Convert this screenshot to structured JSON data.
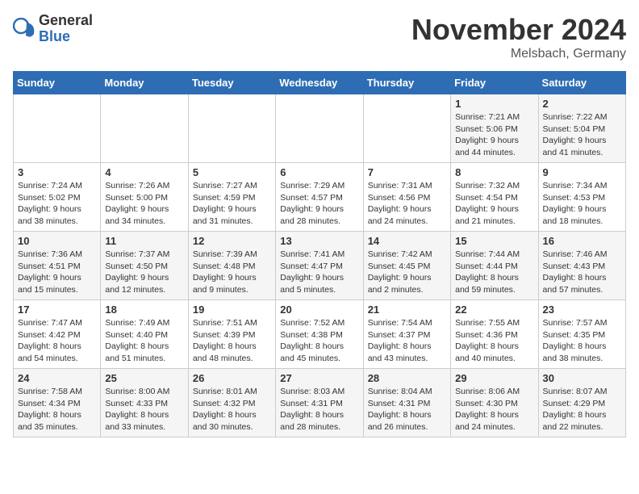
{
  "header": {
    "logo_general": "General",
    "logo_blue": "Blue",
    "month_title": "November 2024",
    "location": "Melsbach, Germany"
  },
  "weekdays": [
    "Sunday",
    "Monday",
    "Tuesday",
    "Wednesday",
    "Thursday",
    "Friday",
    "Saturday"
  ],
  "weeks": [
    [
      {
        "day": "",
        "content": ""
      },
      {
        "day": "",
        "content": ""
      },
      {
        "day": "",
        "content": ""
      },
      {
        "day": "",
        "content": ""
      },
      {
        "day": "",
        "content": ""
      },
      {
        "day": "1",
        "content": "Sunrise: 7:21 AM\nSunset: 5:06 PM\nDaylight: 9 hours and 44 minutes."
      },
      {
        "day": "2",
        "content": "Sunrise: 7:22 AM\nSunset: 5:04 PM\nDaylight: 9 hours and 41 minutes."
      }
    ],
    [
      {
        "day": "3",
        "content": "Sunrise: 7:24 AM\nSunset: 5:02 PM\nDaylight: 9 hours and 38 minutes."
      },
      {
        "day": "4",
        "content": "Sunrise: 7:26 AM\nSunset: 5:00 PM\nDaylight: 9 hours and 34 minutes."
      },
      {
        "day": "5",
        "content": "Sunrise: 7:27 AM\nSunset: 4:59 PM\nDaylight: 9 hours and 31 minutes."
      },
      {
        "day": "6",
        "content": "Sunrise: 7:29 AM\nSunset: 4:57 PM\nDaylight: 9 hours and 28 minutes."
      },
      {
        "day": "7",
        "content": "Sunrise: 7:31 AM\nSunset: 4:56 PM\nDaylight: 9 hours and 24 minutes."
      },
      {
        "day": "8",
        "content": "Sunrise: 7:32 AM\nSunset: 4:54 PM\nDaylight: 9 hours and 21 minutes."
      },
      {
        "day": "9",
        "content": "Sunrise: 7:34 AM\nSunset: 4:53 PM\nDaylight: 9 hours and 18 minutes."
      }
    ],
    [
      {
        "day": "10",
        "content": "Sunrise: 7:36 AM\nSunset: 4:51 PM\nDaylight: 9 hours and 15 minutes."
      },
      {
        "day": "11",
        "content": "Sunrise: 7:37 AM\nSunset: 4:50 PM\nDaylight: 9 hours and 12 minutes."
      },
      {
        "day": "12",
        "content": "Sunrise: 7:39 AM\nSunset: 4:48 PM\nDaylight: 9 hours and 9 minutes."
      },
      {
        "day": "13",
        "content": "Sunrise: 7:41 AM\nSunset: 4:47 PM\nDaylight: 9 hours and 5 minutes."
      },
      {
        "day": "14",
        "content": "Sunrise: 7:42 AM\nSunset: 4:45 PM\nDaylight: 9 hours and 2 minutes."
      },
      {
        "day": "15",
        "content": "Sunrise: 7:44 AM\nSunset: 4:44 PM\nDaylight: 8 hours and 59 minutes."
      },
      {
        "day": "16",
        "content": "Sunrise: 7:46 AM\nSunset: 4:43 PM\nDaylight: 8 hours and 57 minutes."
      }
    ],
    [
      {
        "day": "17",
        "content": "Sunrise: 7:47 AM\nSunset: 4:42 PM\nDaylight: 8 hours and 54 minutes."
      },
      {
        "day": "18",
        "content": "Sunrise: 7:49 AM\nSunset: 4:40 PM\nDaylight: 8 hours and 51 minutes."
      },
      {
        "day": "19",
        "content": "Sunrise: 7:51 AM\nSunset: 4:39 PM\nDaylight: 8 hours and 48 minutes."
      },
      {
        "day": "20",
        "content": "Sunrise: 7:52 AM\nSunset: 4:38 PM\nDaylight: 8 hours and 45 minutes."
      },
      {
        "day": "21",
        "content": "Sunrise: 7:54 AM\nSunset: 4:37 PM\nDaylight: 8 hours and 43 minutes."
      },
      {
        "day": "22",
        "content": "Sunrise: 7:55 AM\nSunset: 4:36 PM\nDaylight: 8 hours and 40 minutes."
      },
      {
        "day": "23",
        "content": "Sunrise: 7:57 AM\nSunset: 4:35 PM\nDaylight: 8 hours and 38 minutes."
      }
    ],
    [
      {
        "day": "24",
        "content": "Sunrise: 7:58 AM\nSunset: 4:34 PM\nDaylight: 8 hours and 35 minutes."
      },
      {
        "day": "25",
        "content": "Sunrise: 8:00 AM\nSunset: 4:33 PM\nDaylight: 8 hours and 33 minutes."
      },
      {
        "day": "26",
        "content": "Sunrise: 8:01 AM\nSunset: 4:32 PM\nDaylight: 8 hours and 30 minutes."
      },
      {
        "day": "27",
        "content": "Sunrise: 8:03 AM\nSunset: 4:31 PM\nDaylight: 8 hours and 28 minutes."
      },
      {
        "day": "28",
        "content": "Sunrise: 8:04 AM\nSunset: 4:31 PM\nDaylight: 8 hours and 26 minutes."
      },
      {
        "day": "29",
        "content": "Sunrise: 8:06 AM\nSunset: 4:30 PM\nDaylight: 8 hours and 24 minutes."
      },
      {
        "day": "30",
        "content": "Sunrise: 8:07 AM\nSunset: 4:29 PM\nDaylight: 8 hours and 22 minutes."
      }
    ]
  ]
}
